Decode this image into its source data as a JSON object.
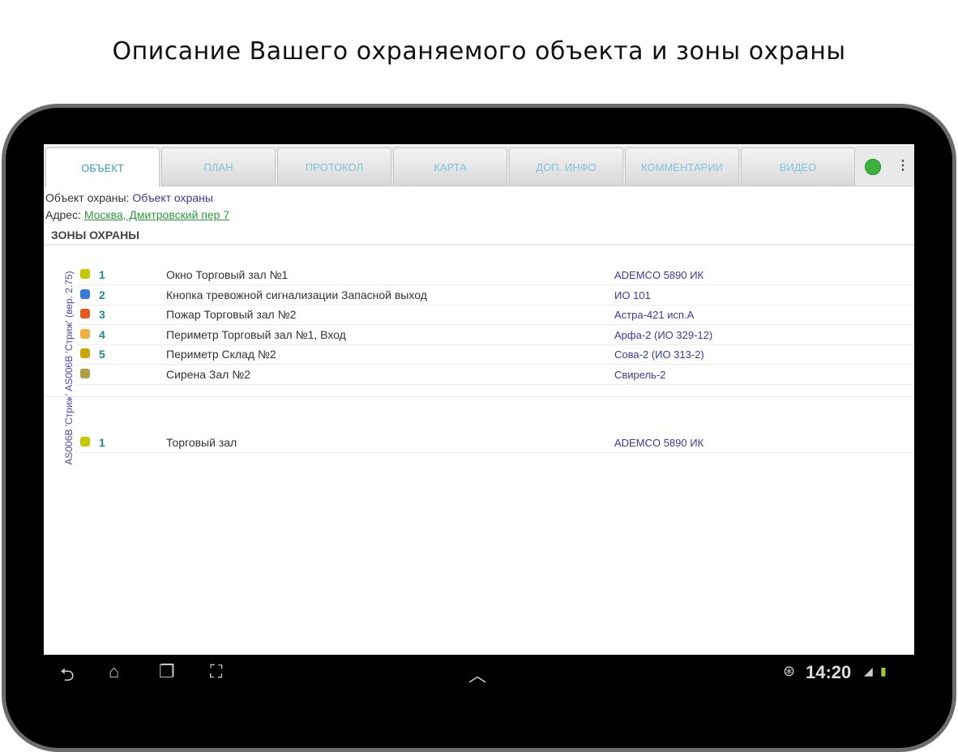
{
  "caption": "Описание Вашего охраняемого объекта и зоны охраны",
  "tabs": [
    {
      "label": "ОБЪЕКТ"
    },
    {
      "label": "ПЛАН"
    },
    {
      "label": "ПРОТОКОЛ"
    },
    {
      "label": "КАРТА"
    },
    {
      "label": "ДОП. ИНФО"
    },
    {
      "label": "КОММЕНТАРИИ"
    },
    {
      "label": "ВИДЕО"
    }
  ],
  "object": {
    "label": "Объект охраны:",
    "value": "Объект охраны"
  },
  "address": {
    "label": "Адрес:",
    "value": "Москва, Дмитровский пер 7"
  },
  "zones_header": "ЗОНЫ ОХРАНЫ",
  "device_label": "AS006B 'Стриж' AS006B 'Стриж' (вер. 2.75)",
  "zones": [
    {
      "icon": "window-sensor-icon",
      "color": "#c8c800",
      "num": "1",
      "name": "Окно Торговый зал №1",
      "device": "ADEMCO 5890 ИК"
    },
    {
      "icon": "panic-button-icon",
      "color": "#3a7ad8",
      "num": "2",
      "name": "Кнопка тревожной сигнализации Запасной выход",
      "device": "ИО 101"
    },
    {
      "icon": "fire-icon",
      "color": "#e85a1a",
      "num": "3",
      "name": "Пожар Торговый зал №2",
      "device": "Астра-421 исп.А"
    },
    {
      "icon": "perimeter-icon",
      "color": "#f0b040",
      "num": "4",
      "name": "Периметр Торговый зал №1, Вход",
      "device": "Арфа-2 (ИО 329-12)"
    },
    {
      "icon": "perimeter-alert-icon",
      "color": "#c8a800",
      "num": "5",
      "name": "Периметр Склад №2",
      "device": "Сова-2 (ИО 313-2)"
    },
    {
      "icon": "siren-icon",
      "color": "#b0a040",
      "num": "",
      "name": "Сирена Зал №2",
      "device": "Свирель-2"
    }
  ],
  "zones2": [
    {
      "icon": "window-sensor-icon",
      "color": "#c8c800",
      "num": "1",
      "name": "Торговый зал",
      "device": "ADEMCO 5890 ИК"
    }
  ],
  "status": {
    "time": "14:20",
    "connection_color": "#3cb33c"
  }
}
